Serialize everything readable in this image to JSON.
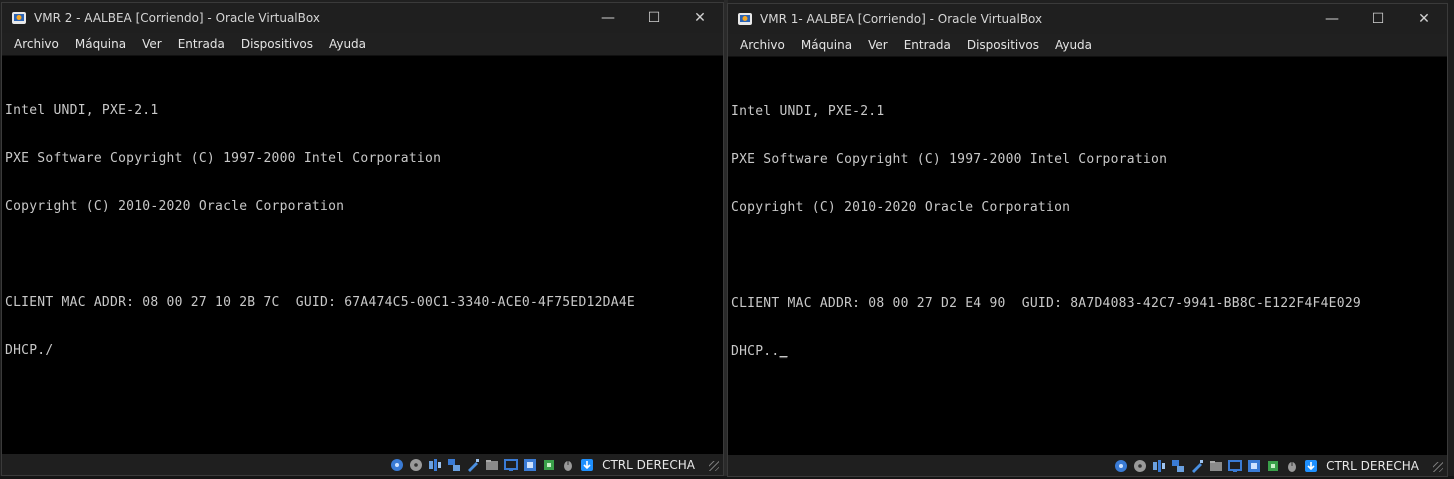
{
  "windows": [
    {
      "title": "VMR 2 - AALBEA [Corriendo] - Oracle VirtualBox",
      "menu": [
        "Archivo",
        "Máquina",
        "Ver",
        "Entrada",
        "Dispositivos",
        "Ayuda"
      ],
      "console": [
        "Intel UNDI, PXE-2.1",
        "PXE Software Copyright (C) 1997-2000 Intel Corporation",
        "Copyright (C) 2010-2020 Oracle Corporation",
        "",
        "CLIENT MAC ADDR: 08 00 27 10 2B 7C  GUID: 67A474C5-00C1-3340-ACE0-4F75ED12DA4E",
        "DHCP./"
      ],
      "host_key": "CTRL DERECHA"
    },
    {
      "title": "VMR 1- AALBEA [Corriendo] - Oracle VirtualBox",
      "menu": [
        "Archivo",
        "Máquina",
        "Ver",
        "Entrada",
        "Dispositivos",
        "Ayuda"
      ],
      "console": [
        "Intel UNDI, PXE-2.1",
        "PXE Software Copyright (C) 1997-2000 Intel Corporation",
        "Copyright (C) 2010-2020 Oracle Corporation",
        "",
        "CLIENT MAC ADDR: 08 00 27 D2 E4 90  GUID: 8A7D4083-42C7-9941-BB8C-E122F4F4E029",
        "DHCP.."
      ],
      "cursor": "_",
      "host_key": "CTRL DERECHA"
    }
  ],
  "controls": {
    "minimize": "—",
    "maximize": "☐",
    "close": "✕"
  },
  "status_icons": [
    "hard-disk-icon",
    "optical-drive-icon",
    "audio-icon",
    "network-icon",
    "usb-icon",
    "shared-folders-icon",
    "display-icon",
    "recording-icon",
    "cpu-icon",
    "mouse-integration-icon",
    "host-key-icon"
  ],
  "colors": {
    "titlebar": "#1f1f1f",
    "console_text": "#c8c8c8",
    "console_bg": "#000000",
    "accent": "#1e90ff"
  }
}
